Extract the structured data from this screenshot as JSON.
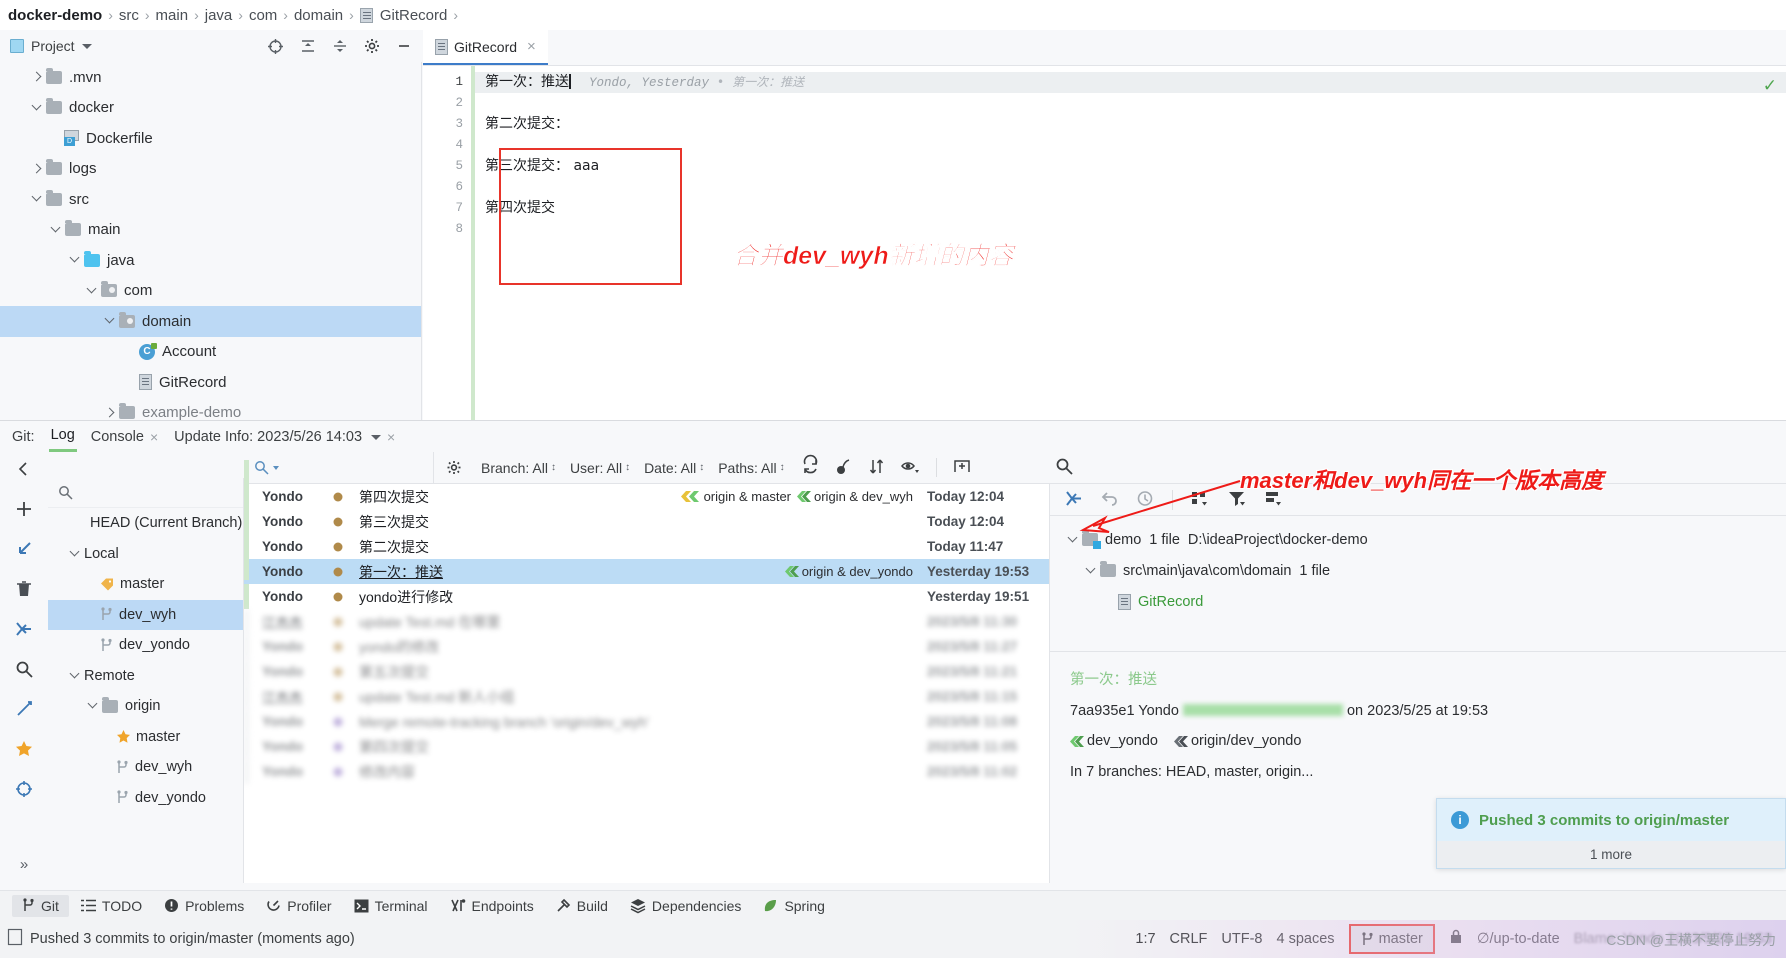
{
  "breadcrumb": {
    "project": "docker-demo",
    "items": [
      "src",
      "main",
      "java",
      "com",
      "domain"
    ],
    "file": "GitRecord",
    "separator": "›"
  },
  "project_panel": {
    "title": "Project",
    "actions": [
      "locate-icon",
      "expand-all-icon",
      "collapse-all-icon",
      "settings-gear-icon",
      "minimize-icon"
    ],
    "tree": [
      {
        "label": ".mvn",
        "type": "folder",
        "arrow": "right",
        "depth": 1
      },
      {
        "label": "docker",
        "type": "folder",
        "arrow": "down",
        "depth": 1
      },
      {
        "label": "Dockerfile",
        "type": "dockerfile",
        "arrow": "none",
        "depth": 2
      },
      {
        "label": "logs",
        "type": "folder",
        "arrow": "right",
        "depth": 1
      },
      {
        "label": "src",
        "type": "folder",
        "arrow": "down",
        "depth": 1
      },
      {
        "label": "main",
        "type": "folder",
        "arrow": "down",
        "depth": 2
      },
      {
        "label": "java",
        "type": "folder-blue",
        "arrow": "down",
        "depth": 3
      },
      {
        "label": "com",
        "type": "package",
        "arrow": "down",
        "depth": 4
      },
      {
        "label": "domain",
        "type": "package",
        "arrow": "down",
        "depth": 5,
        "selected": true
      },
      {
        "label": "Account",
        "type": "class",
        "arrow": "none",
        "depth": 6
      },
      {
        "label": "GitRecord",
        "type": "file",
        "arrow": "none",
        "depth": 6
      },
      {
        "label": "example-demo",
        "type": "folder",
        "arrow": "right",
        "depth": 5,
        "cut": true
      }
    ]
  },
  "editor": {
    "tab": {
      "label": "GitRecord",
      "close": "×"
    },
    "gutter": [
      "1",
      "2",
      "3",
      "4",
      "5",
      "6",
      "7",
      "8"
    ],
    "lines": [
      {
        "text": "第一次：推送",
        "caret": true,
        "blame": "Yondo, Yesterday",
        "blame_sep": "•",
        "blame_msg": "第一次：推送"
      },
      {
        "text": ""
      },
      {
        "text": "第二次提交："
      },
      {
        "text": ""
      },
      {
        "text": "第三次提交： aaa"
      },
      {
        "text": ""
      },
      {
        "text": "第四次提交"
      },
      {
        "text": ""
      }
    ],
    "annotation": "合并dev_wyh新增的内容",
    "inspection_status": "✓"
  },
  "git_window": {
    "label": "Git:",
    "tabs": [
      {
        "label": "Log",
        "selected": true
      },
      {
        "label": "Console",
        "close": "×"
      },
      {
        "label": "Update Info: 2023/5/26 14:03",
        "dropdown": true,
        "close": "×"
      }
    ],
    "rail_icons": [
      "back-icon",
      "add-icon",
      "pull-icon",
      "delete-icon",
      "merge-icon",
      "search-icon",
      "rebase-icon",
      "favorite-star-icon",
      "locate-icon",
      "more-icon"
    ],
    "branches_search_placeholder": "",
    "branches": [
      {
        "label": "HEAD (Current Branch)",
        "type": "head",
        "depth": 1
      },
      {
        "label": "Local",
        "type": "group",
        "depth": 0,
        "arrow": "down"
      },
      {
        "label": "master",
        "type": "tag",
        "depth": 2
      },
      {
        "label": "dev_wyh",
        "type": "branch",
        "depth": 2,
        "selected": true
      },
      {
        "label": "dev_yondo",
        "type": "branch",
        "depth": 2
      },
      {
        "label": "Remote",
        "type": "group",
        "depth": 0,
        "arrow": "down"
      },
      {
        "label": "origin",
        "type": "folder",
        "depth": 1,
        "arrow": "down"
      },
      {
        "label": "master",
        "type": "star",
        "depth": 2
      },
      {
        "label": "dev_wyh",
        "type": "branch",
        "depth": 2
      },
      {
        "label": "dev_yondo",
        "type": "branch",
        "depth": 2,
        "cut": true
      }
    ],
    "log_toolbar": {
      "filters": [
        {
          "label": "Branch: All"
        },
        {
          "label": "User: All"
        },
        {
          "label": "Date: All"
        },
        {
          "label": "Paths: All"
        }
      ],
      "icons": [
        "refresh-icon",
        "cherry-pick-icon",
        "sort-icon",
        "eye-icon",
        "new-tab-icon",
        "search-icon"
      ]
    },
    "commits": [
      {
        "author": "Yondo",
        "message": "第四次提交",
        "refs": [
          {
            "label": "origin & master",
            "color": "#e8c23a"
          },
          {
            "label": "origin & dev_wyh",
            "color": "#6fc96f"
          }
        ],
        "date": "Today 12:04"
      },
      {
        "author": "Yondo",
        "message": "第三次提交",
        "refs": [],
        "date": "Today 12:04"
      },
      {
        "author": "Yondo",
        "message": "第二次提交",
        "refs": [],
        "date": "Today 11:47"
      },
      {
        "author": "Yondo",
        "message": "第一次：推送",
        "refs": [
          {
            "label": "origin & dev_yondo",
            "color": "#6fc96f"
          }
        ],
        "date": "Yesterday 19:53",
        "selected": true
      },
      {
        "author": "Yondo",
        "message": "yondo进行修改",
        "refs": [],
        "date": "Yesterday 19:51"
      },
      {
        "author": "江杰杰",
        "message": "update Test.md 在哪里",
        "refs": [],
        "date": "2023/5/8 11:30",
        "blurred": true
      },
      {
        "author": "Yondo",
        "message": "yondo的修改",
        "refs": [],
        "date": "2023/5/8 11:27",
        "blurred": true
      },
      {
        "author": "Yondo",
        "message": "第五次提交",
        "refs": [],
        "date": "2023/5/8 11:21",
        "blurred": true
      },
      {
        "author": "江杰杰",
        "message": "update Test.md 新人小组",
        "refs": [],
        "date": "2023/5/8 11:15",
        "blurred": true
      },
      {
        "author": "Yondo",
        "message": "Merge remote-tracking branch 'origin/dev_wyh'",
        "refs": [],
        "date": "2023/5/8 11:08",
        "blurred": true
      },
      {
        "author": "Yondo",
        "message": "第四次提交",
        "refs": [],
        "date": "2023/5/8 11:05",
        "blurred": true
      },
      {
        "author": "Yondo",
        "message": "修改内容",
        "refs": [],
        "date": "2023/5/8 11:02",
        "blurred": true
      }
    ],
    "changes_toolbar_icons": [
      "merge-icon",
      "revert-icon",
      "history-icon",
      "group-by-icon",
      "filter-icon",
      "view-options-icon"
    ],
    "changes_tree": [
      {
        "label": "demo",
        "extra": "1 file",
        "path": "D:\\ideaProject\\docker-demo",
        "type": "module",
        "depth": 0,
        "arrow": "down"
      },
      {
        "label": "src\\main\\java\\com\\domain",
        "extra": "1 file",
        "type": "folder",
        "depth": 1,
        "arrow": "down"
      },
      {
        "label": "GitRecord",
        "type": "file",
        "depth": 2,
        "color": "#3a9a3a"
      }
    ],
    "commit_details": {
      "message": "第一次：推送",
      "hash": "7aa935e1",
      "author": "Yondo",
      "email_masked": true,
      "on_date": "on 2023/5/25 at 19:53",
      "refs": [
        {
          "label": "dev_yondo",
          "color": "#6fc96f"
        },
        {
          "label": "origin/dev_yondo",
          "color": "#4a4f55"
        }
      ],
      "branches_line": "In 7 branches: HEAD, master, origin..."
    },
    "annotation": "master和dev_wyh同在一个版本高度"
  },
  "notification": {
    "icon": "info-icon",
    "text": "Pushed 3 commits to origin/master",
    "more": "1 more"
  },
  "bottom_toolbar": [
    {
      "label": "Git",
      "icon": "branch-icon",
      "active": true
    },
    {
      "label": "TODO",
      "icon": "list-icon"
    },
    {
      "label": "Problems",
      "icon": "warning-icon"
    },
    {
      "label": "Profiler",
      "icon": "profiler-icon"
    },
    {
      "label": "Terminal",
      "icon": "terminal-icon"
    },
    {
      "label": "Endpoints",
      "icon": "endpoints-icon"
    },
    {
      "label": "Build",
      "icon": "hammer-icon"
    },
    {
      "label": "Dependencies",
      "icon": "layers-icon"
    },
    {
      "label": "Spring",
      "icon": "leaf-icon"
    }
  ],
  "status_bar": {
    "message": "Pushed 3 commits to origin/master (moments ago)",
    "caret_position": "1:7",
    "line_separator": "CRLF",
    "encoding": "UTF-8",
    "indent": "4 spaces",
    "branch": "master",
    "lock": "lock-icon",
    "updated": "∅/up-to-date",
    "blame": "Blame: Yondo 2023/5/25 19:53",
    "watermark": "CSDN @王横不要停止努力"
  }
}
